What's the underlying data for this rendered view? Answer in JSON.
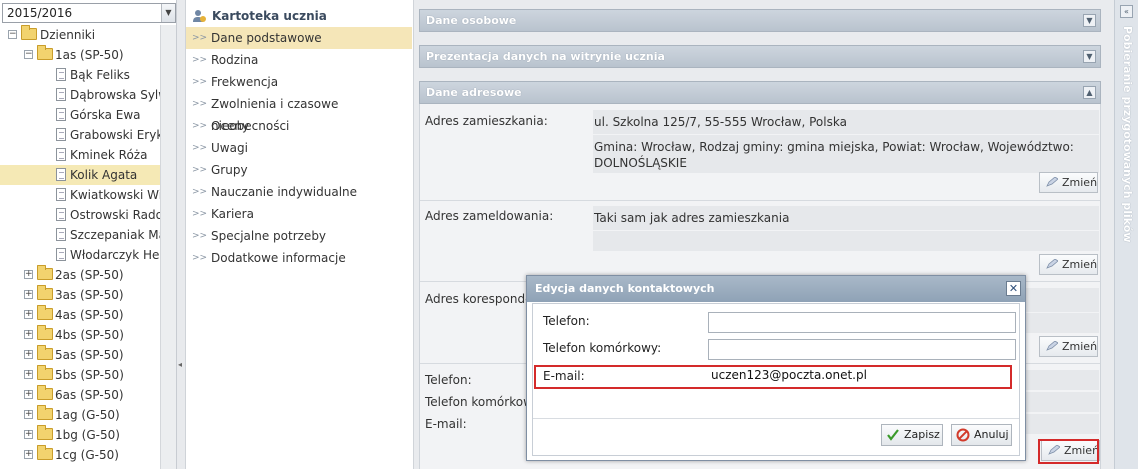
{
  "year_select": {
    "value": "2015/2016"
  },
  "tree": {
    "root": "Dzienniki",
    "open_class": "1as (SP-50)",
    "students": [
      "Bąk Feliks",
      "Dąbrowska Sylwia",
      "Górska Ewa",
      "Grabowski Eryk",
      "Kminek Róża",
      "Kolik Agata",
      "Kwiatkowski Wikto",
      "Ostrowski Radosła",
      "Szczepaniak Macie",
      "Włodarczyk Helena"
    ],
    "selected_student": "Kolik Agata",
    "classes": [
      "2as (SP-50)",
      "3as (SP-50)",
      "4as (SP-50)",
      "4bs (SP-50)",
      "5as (SP-50)",
      "5bs (SP-50)",
      "6as (SP-50)",
      "1ag (G-50)",
      "1bg (G-50)",
      "1cg (G-50)"
    ]
  },
  "card": {
    "title": "Kartoteka ucznia",
    "items": [
      "Dane podstawowe",
      "Rodzina",
      "Frekwencja",
      "Zwolnienia i czasowe nieobecności",
      "Oceny",
      "Uwagi",
      "Grupy",
      "Nauczanie indywidualne",
      "Kariera",
      "Specjalne potrzeby",
      "Dodatkowe informacje"
    ],
    "active": "Dane podstawowe"
  },
  "sections": {
    "personal": "Dane osobowe",
    "website": "Prezentacja danych na witrynie ucznia",
    "address": "Dane adresowe"
  },
  "address": {
    "residence_label": "Adres zamieszkania:",
    "residence_line1": "ul. Szkolna 125/7, 55-555 Wrocław, Polska",
    "residence_line2": "Gmina: Wrocław, Rodzaj gminy: gmina miejska, Powiat: Wrocław, Województwo:",
    "residence_line3": "DOLNOŚLĄSKIE",
    "registration_label": "Adres zameldowania:",
    "registration_value": "Taki sam jak adres zamieszkania",
    "correspondence_label": "Adres koresponden",
    "phone_label": "Telefon:",
    "mobile_label": "Telefon komórkowy",
    "email_label": "E-mail:",
    "change_label": "Zmień"
  },
  "right_panel": {
    "title": "Pobieranie przygotowanych plików"
  },
  "modal": {
    "title": "Edycja danych kontaktowych",
    "phone_label": "Telefon:",
    "phone_value": "",
    "mobile_label": "Telefon komórkowy:",
    "mobile_value": "",
    "email_label": "E-mail:",
    "email_value": "uczen123@poczta.onet.pl",
    "save_label": "Zapisz",
    "cancel_label": "Anuluj"
  },
  "colors": {
    "highlight_red": "#d42a2a",
    "selected_bg": "#f5e6b8",
    "header_blue": "#9aabbd"
  }
}
